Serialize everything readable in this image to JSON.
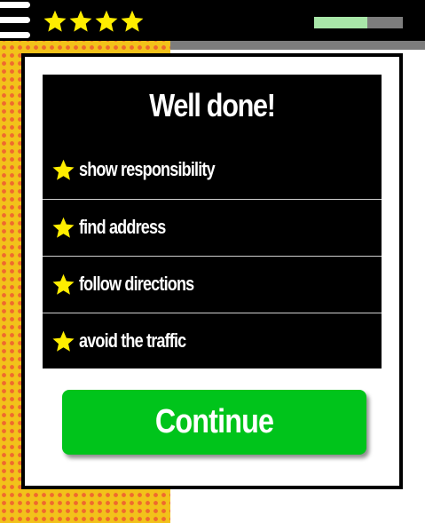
{
  "header": {
    "stars_earned": 4,
    "progress_fraction": 0.6,
    "icons": {
      "menu": "hamburger-icon",
      "star": "star-icon"
    },
    "colors": {
      "star": "#ffed00",
      "progress_fill": "#a8e6a8",
      "progress_track": "#7d7d7d"
    }
  },
  "dialog": {
    "title": "Well done!",
    "achievements": [
      {
        "label": "show responsibility"
      },
      {
        "label": "find address"
      },
      {
        "label": "follow directions"
      },
      {
        "label": "avoid the traffic"
      }
    ],
    "continue_label": "Continue",
    "colors": {
      "button": "#00c41b",
      "panel": "#000000"
    }
  }
}
